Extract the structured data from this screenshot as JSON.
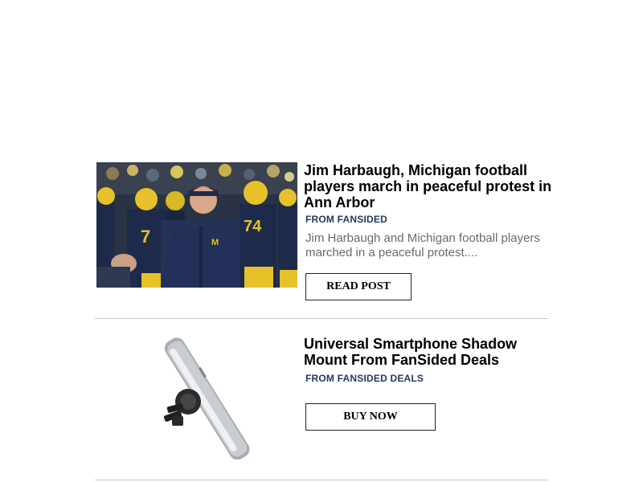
{
  "feed": {
    "items": [
      {
        "headline": "Jim Harbaugh, Michigan football players march in peaceful protest in Ann Arbor",
        "source": "FROM FANSIDED",
        "excerpt": "Jim Harbaugh and Michigan football players marched in a peaceful protest....",
        "cta_label": "READ POST",
        "image_alt": "michigan-football-team-photo"
      },
      {
        "headline": "Universal Smartphone Shadow Mount From FanSided Deals",
        "source": "FROM FANSIDED DEALS",
        "cta_label": "BUY NOW",
        "image_alt": "smartphone-car-mount-photo"
      }
    ]
  },
  "colors": {
    "source_text": "#1f3a5c",
    "headline_text": "#000000",
    "excerpt_text": "#6a6a6a",
    "divider": "#c8c8c8",
    "jersey_blue": "#1d2a4a",
    "helmet_maize": "#e6c12a"
  }
}
